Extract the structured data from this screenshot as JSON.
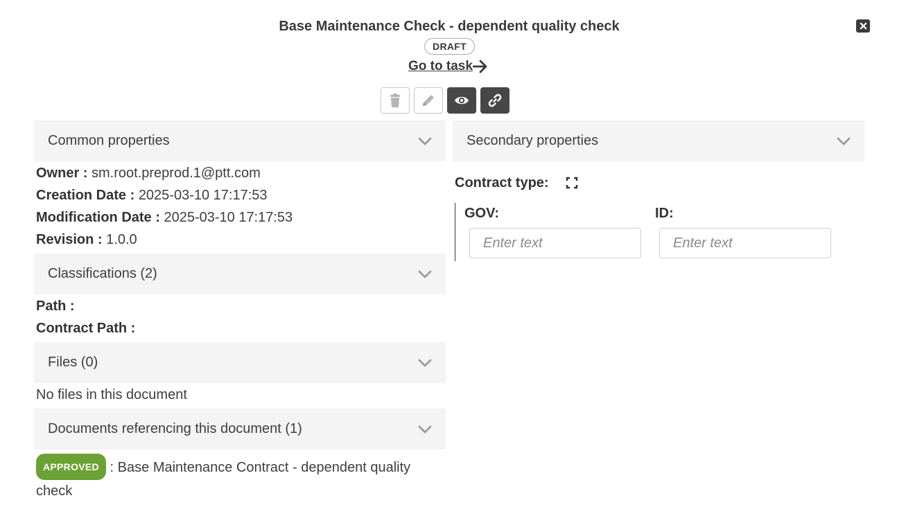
{
  "header": {
    "title": "Base Maintenance Check - dependent quality check",
    "status": "DRAFT",
    "goto_task": "Go to task"
  },
  "toolbar": {
    "icons": [
      "trash-icon",
      "pencil-icon",
      "eye-icon",
      "link-icon"
    ]
  },
  "common": {
    "heading": "Common properties",
    "owner_label": "Owner :",
    "owner_value": "sm.root.preprod.1@ptt.com",
    "creation_label": "Creation Date :",
    "creation_value": "2025-03-10 17:17:53",
    "modification_label": "Modification Date :",
    "modification_value": "2025-03-10 17:17:53",
    "revision_label": "Revision :",
    "revision_value": "1.0.0"
  },
  "classifications": {
    "heading": "Classifications (2)",
    "path_label": "Path :",
    "contract_path_label": "Contract Path :"
  },
  "files": {
    "heading": "Files (0)",
    "empty_text": "No files in this document"
  },
  "references": {
    "heading": "Documents referencing this document (1)",
    "badge": "APPROVED",
    "separator": ":",
    "doc_title": "Base Maintenance Contract - dependent quality check"
  },
  "secondary": {
    "heading": "Secondary properties",
    "contract_type_label": "Contract type:",
    "gov_label": "GOV:",
    "gov_placeholder": "Enter text",
    "id_label": "ID:",
    "id_placeholder": "Enter text"
  },
  "colors": {
    "accordion_bg": "#f4f4f4",
    "approved": "#6aa334",
    "dark_button": "#474747"
  }
}
